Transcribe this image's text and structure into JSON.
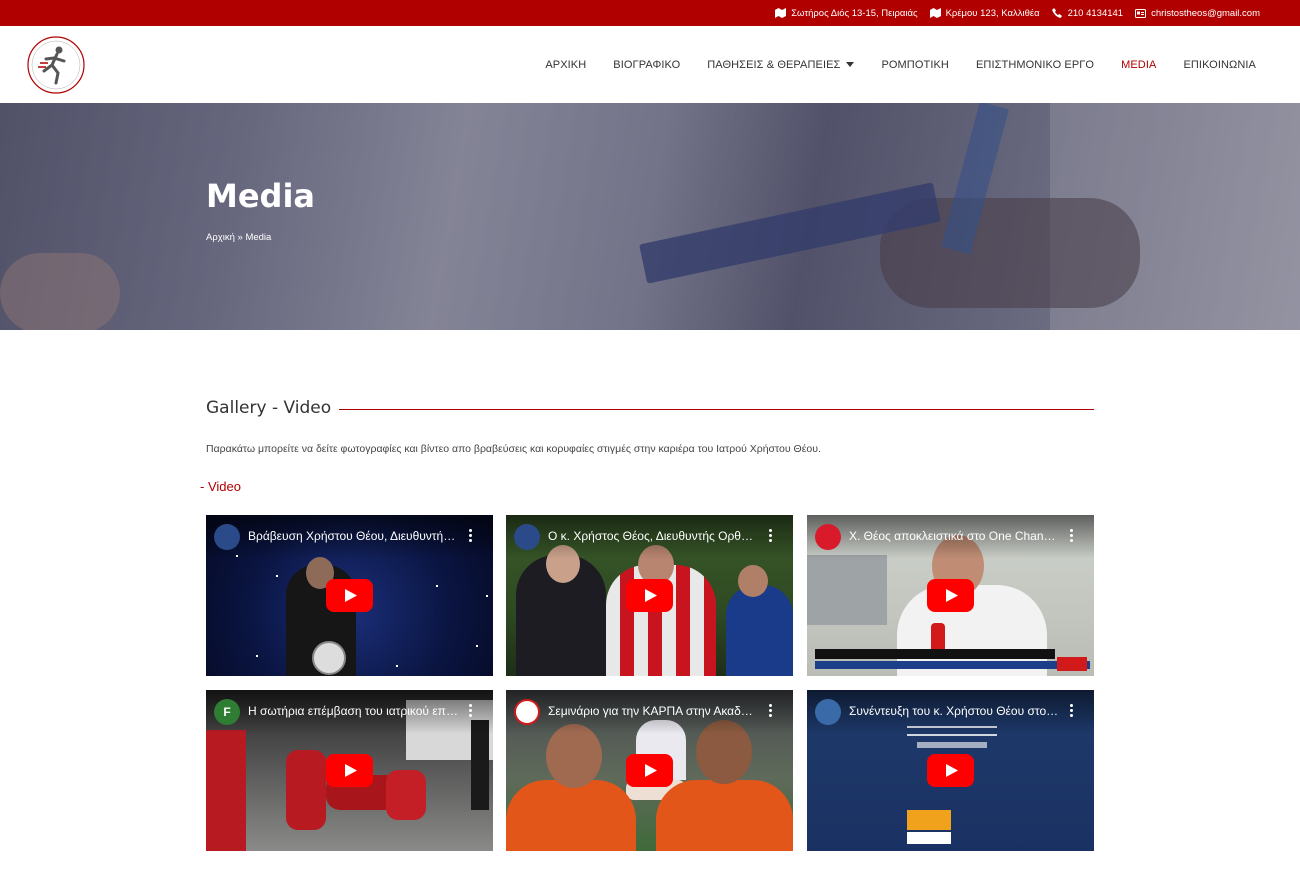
{
  "topbar": {
    "address1": "Σωτήρος Διός 13-15, Πειραιάς",
    "address2": "Κρέμου 123, Καλλιθέα",
    "phone": "210 4134141",
    "email": "christostheos@gmail.com"
  },
  "nav": {
    "items": [
      {
        "label": "ΑΡΧΙΚΗ"
      },
      {
        "label": "ΒΙΟΓΡΑΦΙΚΟ"
      },
      {
        "label": "ΠΑΘΗΣΕΙΣ & ΘΕΡΑΠΕΙΕΣ"
      },
      {
        "label": "ΡΟΜΠΟΤΙΚΗ"
      },
      {
        "label": "ΕΠΙΣΤΗΜΟΝΙΚΟ ΕΡΓΟ"
      },
      {
        "label": "MEDIA"
      },
      {
        "label": "ΕΠΙΚΟΙΝΩΝΙΑ"
      }
    ],
    "active_color": "#b10000"
  },
  "hero": {
    "title": "Media",
    "breadcrumb_home": "Αρχική",
    "breadcrumb_sep": " » ",
    "breadcrumb_current": "Media"
  },
  "content": {
    "section_title": "Gallery - Video",
    "intro": "Παρακάτω μπορείτε να δείτε φωτογραφίες και βίντεο απο βραβεύσεις και κορυφαίες στιγμές στην καριέρα του Ιατρού Χρήστου Θέου.",
    "video_label": "- Video"
  },
  "videos": [
    {
      "title": "Βράβευση Χρήστου Θέου, Διευθυντή Ορθοπαιδικού",
      "avatar_letter": ""
    },
    {
      "title": "Ο κ. Χρήστος Θέος, Διευθυντής Ορθοπαιδικού",
      "avatar_letter": ""
    },
    {
      "title": "Χ. Θέος αποκλειστικά στο One Channel",
      "avatar_letter": ""
    },
    {
      "title": "Η σωτήρια επέμβαση του ιατρικού επιτελείου",
      "avatar_letter": "F"
    },
    {
      "title": "Σεμινάριο για την ΚΑΡΠΑ στην Ακαδημία",
      "avatar_letter": ""
    },
    {
      "title": "Συνέντευξη του κ. Χρήστου Θέου στο Metropolitan",
      "avatar_letter": ""
    }
  ],
  "colors": {
    "brand_red": "#b10000",
    "youtube_red": "#ff0000"
  }
}
